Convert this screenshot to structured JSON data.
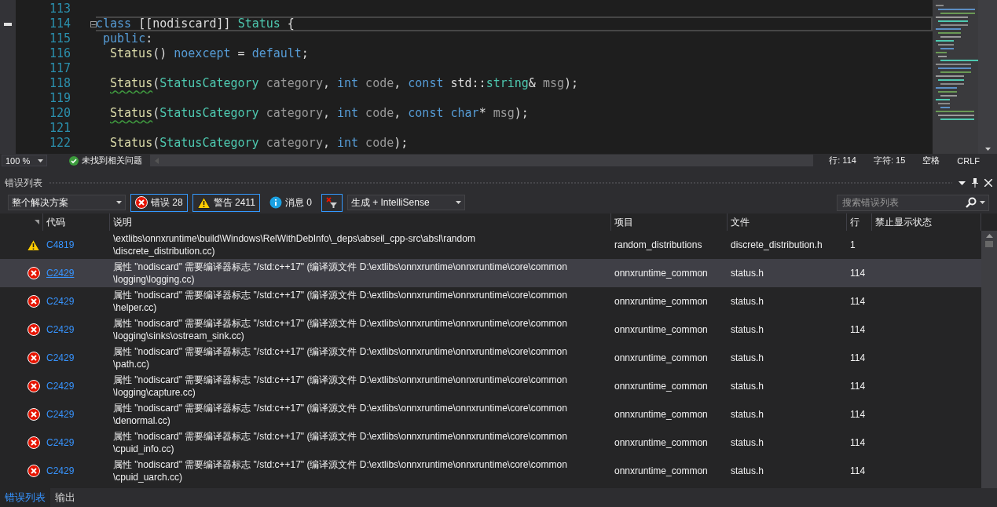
{
  "editor": {
    "lines": [
      {
        "number": "113",
        "current": false
      },
      {
        "number": "114",
        "current": true,
        "fold": "⊟",
        "tokens": [
          {
            "kind": "keyword",
            "text": "class"
          },
          {
            "kind": "plain",
            "text": " [["
          },
          {
            "kind": "attr",
            "text": "nodiscard"
          },
          {
            "kind": "plain",
            "text": "]] "
          },
          {
            "kind": "type",
            "text": "Status"
          },
          {
            "kind": "plain",
            "text": " {"
          }
        ],
        "children": [
          {
            "number": "115",
            "current": false,
            "tokens": [
              {
                "kind": "keyword",
                "text": "public"
              },
              {
                "kind": "plain",
                "text": ":"
              }
            ],
            "children": [
              {
                "number": "116",
                "current": false,
                "tokens": [
                  {
                    "kind": "func",
                    "text": "Status"
                  },
                  {
                    "kind": "plain",
                    "text": "() "
                  },
                  {
                    "kind": "keyword",
                    "text": "noexcept"
                  },
                  {
                    "kind": "plain",
                    "text": " = "
                  },
                  {
                    "kind": "keyword",
                    "text": "default"
                  },
                  {
                    "kind": "plain",
                    "text": ";"
                  }
                ]
              },
              {
                "number": "117",
                "current": false
              },
              {
                "number": "118",
                "current": false,
                "tokens": [
                  {
                    "kind": "func",
                    "text": "Status",
                    "squiggle": true
                  },
                  {
                    "kind": "plain",
                    "text": "("
                  },
                  {
                    "kind": "type",
                    "text": "StatusCategory"
                  },
                  {
                    "kind": "param",
                    "text": " category"
                  },
                  {
                    "kind": "plain",
                    "text": ", "
                  },
                  {
                    "kind": "keyword",
                    "text": "int"
                  },
                  {
                    "kind": "param",
                    "text": " code"
                  },
                  {
                    "kind": "plain",
                    "text": ", "
                  },
                  {
                    "kind": "keyword",
                    "text": "const"
                  },
                  {
                    "kind": "plain",
                    "text": " std::"
                  },
                  {
                    "kind": "type",
                    "text": "string"
                  },
                  {
                    "kind": "plain",
                    "text": "& "
                  },
                  {
                    "kind": "param",
                    "text": "msg"
                  },
                  {
                    "kind": "plain",
                    "text": ");"
                  }
                ]
              },
              {
                "number": "119",
                "current": false
              },
              {
                "number": "120",
                "current": false,
                "tokens": [
                  {
                    "kind": "func",
                    "text": "Status",
                    "squiggle": true
                  },
                  {
                    "kind": "plain",
                    "text": "("
                  },
                  {
                    "kind": "type",
                    "text": "StatusCategory"
                  },
                  {
                    "kind": "param",
                    "text": " category"
                  },
                  {
                    "kind": "plain",
                    "text": ", "
                  },
                  {
                    "kind": "keyword",
                    "text": "int"
                  },
                  {
                    "kind": "param",
                    "text": " code"
                  },
                  {
                    "kind": "plain",
                    "text": ", "
                  },
                  {
                    "kind": "keyword",
                    "text": "const char"
                  },
                  {
                    "kind": "plain",
                    "text": "* "
                  },
                  {
                    "kind": "param",
                    "text": "msg"
                  },
                  {
                    "kind": "plain",
                    "text": ");"
                  }
                ]
              },
              {
                "number": "121",
                "current": false
              },
              {
                "number": "122",
                "current": false,
                "tokens": [
                  {
                    "kind": "func",
                    "text": "Status"
                  },
                  {
                    "kind": "plain",
                    "text": "("
                  },
                  {
                    "kind": "type",
                    "text": "StatusCategory"
                  },
                  {
                    "kind": "param",
                    "text": " category"
                  },
                  {
                    "kind": "plain",
                    "text": ", "
                  },
                  {
                    "kind": "keyword",
                    "text": "int"
                  },
                  {
                    "kind": "param",
                    "text": " code"
                  },
                  {
                    "kind": "plain",
                    "text": ");"
                  }
                ]
              }
            ]
          }
        ]
      }
    ]
  },
  "editor_status": {
    "zoom": "100 %",
    "issues": "未找到相关问题",
    "line": "行: 114",
    "char": "字符: 15",
    "indent": "空格",
    "line_ending": "CRLF"
  },
  "error_list": {
    "title": "错误列表",
    "toolbar": {
      "scope": "整个解决方案",
      "errors": {
        "label": "错误 28",
        "selected": true
      },
      "warnings": {
        "label": "警告 2411",
        "selected": true
      },
      "messages": {
        "label": "消息 0",
        "selected": false
      },
      "filter": {
        "selected": true
      },
      "source": "生成 + IntelliSense",
      "search_placeholder": "搜索错误列表"
    },
    "columns": [
      "代码",
      "说明",
      "项目",
      "文件",
      "行",
      "禁止显示状态"
    ],
    "rows": [
      {
        "kind": "warning",
        "code": "C4819",
        "description": [
          "\\extlibs\\onnxruntime\\build\\Windows\\RelWithDebInfo\\_deps\\abseil_cpp-src\\absl\\random",
          "\\discrete_distribution.cc)"
        ],
        "project": "random_distributions",
        "file": "discrete_distribution.h",
        "line": "1",
        "selected": false
      },
      {
        "kind": "error",
        "code": "C2429",
        "description": [
          "属性 \"nodiscard\" 需要编译器标志 \"/std:c++17\" (编译源文件 D:\\extlibs\\onnxruntime\\onnxruntime\\core\\common",
          "\\logging\\logging.cc)"
        ],
        "project": "onnxruntime_common",
        "file": "status.h",
        "line": "114",
        "selected": true
      },
      {
        "kind": "error",
        "code": "C2429",
        "description": [
          "属性 \"nodiscard\" 需要编译器标志 \"/std:c++17\" (编译源文件 D:\\extlibs\\onnxruntime\\onnxruntime\\core\\common",
          "\\helper.cc)"
        ],
        "project": "onnxruntime_common",
        "file": "status.h",
        "line": "114",
        "selected": false
      },
      {
        "kind": "error",
        "code": "C2429",
        "description": [
          "属性 \"nodiscard\" 需要编译器标志 \"/std:c++17\" (编译源文件 D:\\extlibs\\onnxruntime\\onnxruntime\\core\\common",
          "\\logging\\sinks\\ostream_sink.cc)"
        ],
        "project": "onnxruntime_common",
        "file": "status.h",
        "line": "114",
        "selected": false
      },
      {
        "kind": "error",
        "code": "C2429",
        "description": [
          "属性 \"nodiscard\" 需要编译器标志 \"/std:c++17\" (编译源文件 D:\\extlibs\\onnxruntime\\onnxruntime\\core\\common",
          "\\path.cc)"
        ],
        "project": "onnxruntime_common",
        "file": "status.h",
        "line": "114",
        "selected": false
      },
      {
        "kind": "error",
        "code": "C2429",
        "description": [
          "属性 \"nodiscard\" 需要编译器标志 \"/std:c++17\" (编译源文件 D:\\extlibs\\onnxruntime\\onnxruntime\\core\\common",
          "\\logging\\capture.cc)"
        ],
        "project": "onnxruntime_common",
        "file": "status.h",
        "line": "114",
        "selected": false
      },
      {
        "kind": "error",
        "code": "C2429",
        "description": [
          "属性 \"nodiscard\" 需要编译器标志 \"/std:c++17\" (编译源文件 D:\\extlibs\\onnxruntime\\onnxruntime\\core\\common",
          "\\denormal.cc)"
        ],
        "project": "onnxruntime_common",
        "file": "status.h",
        "line": "114",
        "selected": false
      },
      {
        "kind": "error",
        "code": "C2429",
        "description": [
          "属性 \"nodiscard\" 需要编译器标志 \"/std:c++17\" (编译源文件 D:\\extlibs\\onnxruntime\\onnxruntime\\core\\common",
          "\\cpuid_info.cc)"
        ],
        "project": "onnxruntime_common",
        "file": "status.h",
        "line": "114",
        "selected": false
      },
      {
        "kind": "error",
        "code": "C2429",
        "description": [
          "属性 \"nodiscard\" 需要编译器标志 \"/std:c++17\" (编译源文件 D:\\extlibs\\onnxruntime\\onnxruntime\\core\\common",
          "\\cpuid_uarch.cc)"
        ],
        "project": "onnxruntime_common",
        "file": "status.h",
        "line": "114",
        "selected": false
      }
    ]
  },
  "bottom_tabs": [
    {
      "label": "错误列表",
      "selected": true
    },
    {
      "label": "输出",
      "selected": false
    }
  ]
}
